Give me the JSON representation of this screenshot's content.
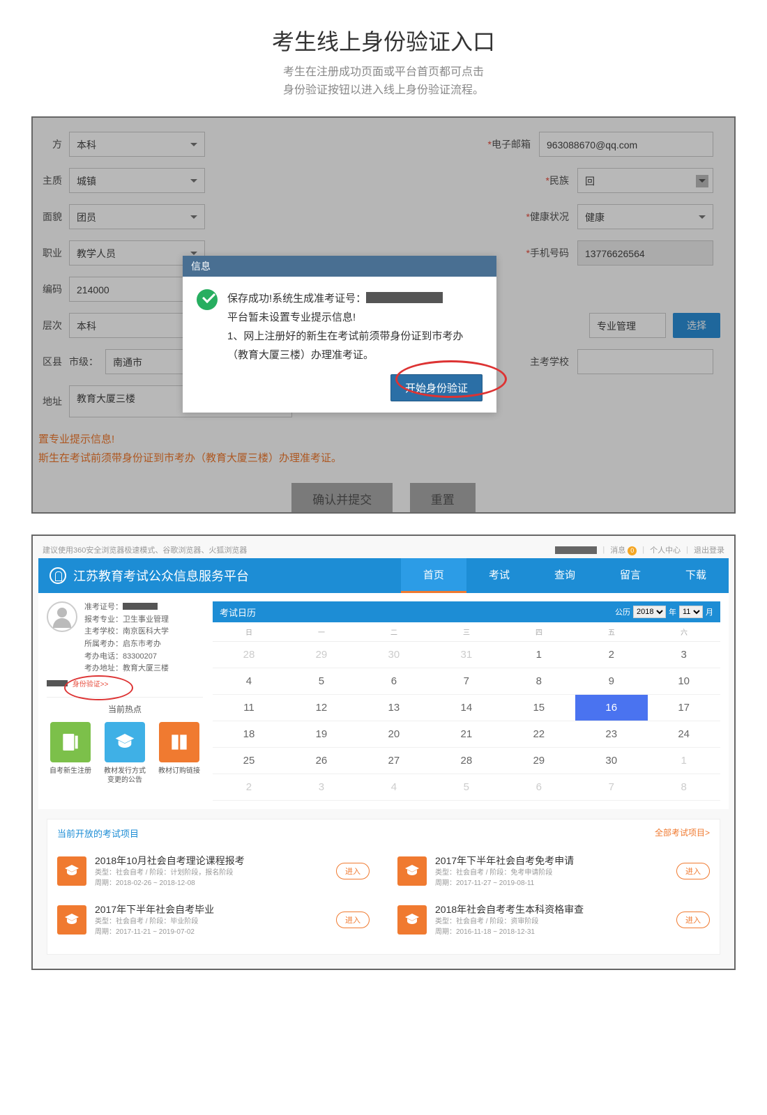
{
  "page": {
    "title": "考生线上身份验证入口",
    "subtitle1": "考生在注册成功页面或平台首页都可点击",
    "subtitle2": "身份验证按钮以进入线上身份验证流程。"
  },
  "shot1": {
    "fields": {
      "degree_l": "方",
      "degree_v": "本科",
      "email_l": "电子邮箱",
      "email_v": "963088670@qq.com",
      "hukou_l": "主质",
      "hukou_v": "城镇",
      "ethnic_l": "民族",
      "ethnic_v": "回",
      "political_l": "面貌",
      "political_v": "团员",
      "health_l": "健康状况",
      "health_v": "健康",
      "job_l": "职业",
      "job_v": "教学人员",
      "phone_l": "手机号码",
      "phone_v": "13776626564",
      "zip_l": "编码",
      "zip_v": "214000",
      "level_l": "层次",
      "level_v": "本科",
      "major_v": "专业管理",
      "select_btn": "选择",
      "district_l": "区县",
      "city_l": "市级：",
      "city_v": "南通市",
      "addr_l": "地址",
      "addr_v": "教育大厦三楼",
      "school_l": "主考学校"
    },
    "warn": {
      "l1": "置专业提示信息!",
      "l2": "斯生在考试前须带身份证到市考办（教育大厦三楼）办理准考证。"
    },
    "btns": {
      "submit": "确认并提交",
      "reset": "重置"
    },
    "modal": {
      "title": "信息",
      "line1a": "保存成功!系统生成准考证号：",
      "line2": "平台暂未设置专业提示信息!",
      "line3": "1、网上注册好的新生在考试前须带身份证到市考办（教育大厦三楼）办理准考证。",
      "btn": "开始身份验证"
    }
  },
  "shot2": {
    "topbar": {
      "tip": "建议使用360安全浏览器极速模式、谷歌浏览器、火狐浏览器",
      "msg": "消息",
      "badge": "0",
      "center": "个人中心",
      "logout": "退出登录"
    },
    "nav": {
      "title": "江苏教育考试公众信息服务平台",
      "items": [
        "首页",
        "考试",
        "查询",
        "留言",
        "下载"
      ]
    },
    "profile": {
      "f1": "准考证号：",
      "f2l": "报考专业：",
      "f2v": "卫生事业管理",
      "f3l": "主考学校：",
      "f3v": "南京医科大学",
      "f4l": "所属考办：",
      "f4v": "启东市考办",
      "f5l": "考办电话：",
      "f5v": "83300207",
      "f6l": "考办地址：",
      "f6v": "教育大厦三楼",
      "verify": "身份验证>>"
    },
    "hot": {
      "title": "当前热点",
      "c1": "自考新生注册",
      "c2": "教材发行方式变更的公告",
      "c3": "教材订购链接"
    },
    "cal": {
      "title": "考试日历",
      "era": "公历",
      "year": "2018",
      "yl": "年",
      "month": "11",
      "ml": "月",
      "wk": [
        "日",
        "一",
        "二",
        "三",
        "四",
        "五",
        "六"
      ],
      "days": [
        {
          "n": "28",
          "pm": true
        },
        {
          "n": "29",
          "pm": true
        },
        {
          "n": "30",
          "pm": true
        },
        {
          "n": "31",
          "pm": true
        },
        {
          "n": "1"
        },
        {
          "n": "2"
        },
        {
          "n": "3"
        },
        {
          "n": "4"
        },
        {
          "n": "5"
        },
        {
          "n": "6"
        },
        {
          "n": "7"
        },
        {
          "n": "8"
        },
        {
          "n": "9"
        },
        {
          "n": "10"
        },
        {
          "n": "11"
        },
        {
          "n": "12"
        },
        {
          "n": "13"
        },
        {
          "n": "14"
        },
        {
          "n": "15"
        },
        {
          "n": "16",
          "today": true
        },
        {
          "n": "17"
        },
        {
          "n": "18"
        },
        {
          "n": "19"
        },
        {
          "n": "20"
        },
        {
          "n": "21"
        },
        {
          "n": "22"
        },
        {
          "n": "23"
        },
        {
          "n": "24"
        },
        {
          "n": "25"
        },
        {
          "n": "26"
        },
        {
          "n": "27"
        },
        {
          "n": "28"
        },
        {
          "n": "29"
        },
        {
          "n": "30"
        },
        {
          "n": "1",
          "pm": true
        },
        {
          "n": "2",
          "pm": true
        },
        {
          "n": "3",
          "pm": true
        },
        {
          "n": "4",
          "pm": true
        },
        {
          "n": "5",
          "pm": true
        },
        {
          "n": "6",
          "pm": true
        },
        {
          "n": "7",
          "pm": true
        },
        {
          "n": "8",
          "pm": true
        }
      ]
    },
    "proj": {
      "title": "当前开放的考试项目",
      "all": "全部考试项目>",
      "enter": "进入",
      "items": [
        {
          "t": "2018年10月社会自考理论课程报考",
          "m": "类型：社会自考 / 阶段：计划阶段，报名阶段",
          "p": "周期：2018-02-26 ~ 2018-12-08"
        },
        {
          "t": "2017年下半年社会自考免考申请",
          "m": "类型：社会自考 / 阶段：免考申请阶段",
          "p": "周期：2017-11-27 ~ 2019-08-11"
        },
        {
          "t": "2017年下半年社会自考毕业",
          "m": "类型：社会自考 / 阶段：毕业阶段",
          "p": "周期：2017-11-21 ~ 2019-07-02"
        },
        {
          "t": "2018年社会自考考生本科资格审查",
          "m": "类型：社会自考 / 阶段：资审阶段",
          "p": "周期：2016-11-18 ~ 2018-12-31"
        }
      ]
    }
  }
}
